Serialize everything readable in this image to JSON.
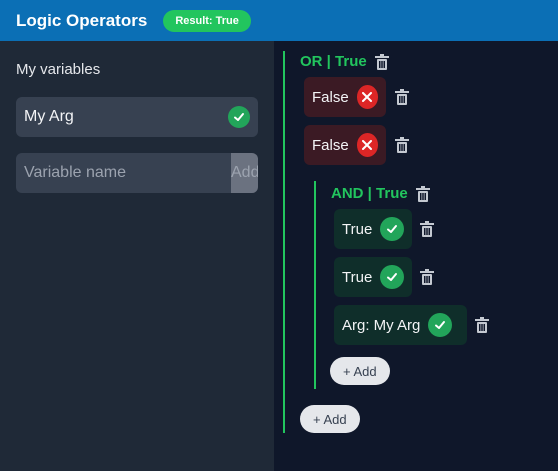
{
  "header": {
    "title": "Logic Operators",
    "result_badge": "Result: True"
  },
  "sidebar": {
    "heading": "My variables",
    "variables": [
      {
        "name": "My Arg",
        "value": "true"
      }
    ],
    "new_variable": {
      "placeholder": "Variable name",
      "value": "",
      "add_label": "Add"
    }
  },
  "tree": {
    "root": {
      "label": "OR | True",
      "conditions": [
        {
          "label": "False",
          "value": false
        },
        {
          "label": "False",
          "value": false
        }
      ],
      "child": {
        "label": "AND | True",
        "conditions": [
          {
            "label": "True",
            "value": true
          },
          {
            "label": "True",
            "value": true
          },
          {
            "label": "Arg: My Arg",
            "value": true
          }
        ],
        "add_label": "+ Add"
      },
      "add_label": "+ Add"
    }
  },
  "colors": {
    "header": "#0b6fb5",
    "accent_green": "#22c55e",
    "false_red": "#dc2626"
  }
}
